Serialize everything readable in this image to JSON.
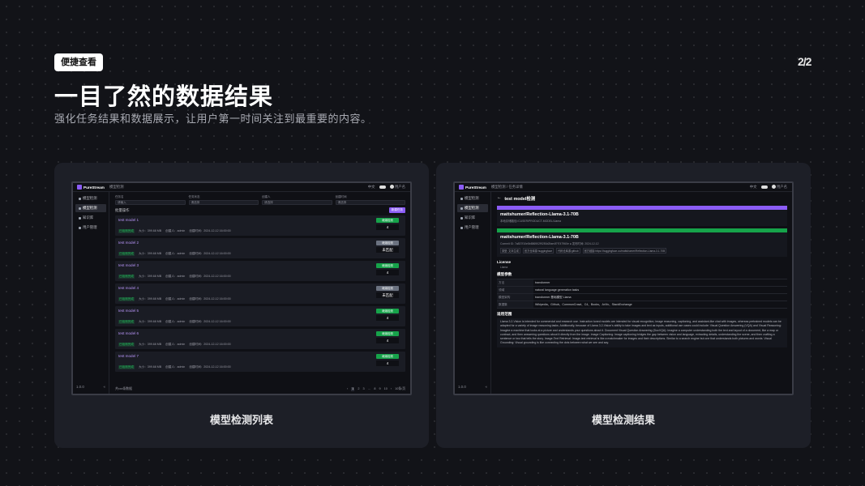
{
  "slide": {
    "tag": "便捷查看",
    "page": "2/2",
    "title": "一目了然的数据结果",
    "subtitle": "强化任务结果和数据展示，让用户第一时间关注到最重要的内容。",
    "left_caption": "模型检测列表",
    "right_caption": "模型检测结果"
  },
  "app": {
    "brand": "PureStream",
    "version": "1.0.0",
    "user": "用户名",
    "lang": "中文",
    "nav": [
      {
        "label": "模型检测"
      },
      {
        "label": "模型检测"
      },
      {
        "label": "知识库"
      },
      {
        "label": "用户管理"
      }
    ]
  },
  "list_screen": {
    "breadcrumb": "模型检测",
    "filters": [
      {
        "label": "任务名",
        "placeholder": "请输入"
      },
      {
        "label": "任务状态",
        "placeholder": "请选择"
      },
      {
        "label": "创建人",
        "placeholder": "请选择"
      },
      {
        "label": "创建时间",
        "placeholder": "请选择"
      }
    ],
    "bulk_label": "批量操作",
    "new_button": "新建任务",
    "rows": [
      {
        "name": "test model 1",
        "status": "已检测完成",
        "size": "大小：399.68 MB",
        "creator": "创建人：admin",
        "time": "创建时间：2024-12-12 16:00:00",
        "action": "继续检测",
        "action_type": "green",
        "count": "4"
      },
      {
        "name": "test model 2",
        "status": "已检测完成",
        "size": "大小：399.68 MB",
        "creator": "创建人：admin",
        "time": "创建时间：2024-12-12 16:00:00",
        "action": "继续检测",
        "action_type": "gray",
        "count": "未匹配"
      },
      {
        "name": "test model 3",
        "status": "已检测完成",
        "size": "大小：399.68 MB",
        "creator": "创建人：admin",
        "time": "创建时间：2024-12-12 16:00:00",
        "action": "继续检测",
        "action_type": "green",
        "count": "4"
      },
      {
        "name": "test model 4",
        "status": "已检测完成",
        "size": "大小：399.68 MB",
        "creator": "创建人：admin",
        "time": "创建时间：2024-12-12 16:00:00",
        "action": "继续检测",
        "action_type": "gray",
        "count": "未匹配"
      },
      {
        "name": "test model 5",
        "status": "已检测完成",
        "size": "大小：399.68 MB",
        "creator": "创建人：admin",
        "time": "创建时间：2024-12-12 16:00:00",
        "action": "继续检测",
        "action_type": "green",
        "count": "4"
      },
      {
        "name": "test model 6",
        "status": "已检测完成",
        "size": "大小：399.68 MB",
        "creator": "创建人：admin",
        "time": "创建时间：2024-12-12 16:00:00",
        "action": "继续检测",
        "action_type": "green",
        "count": "4"
      },
      {
        "name": "test model 7",
        "status": "已检测完成",
        "size": "大小：399.68 MB",
        "creator": "创建人：admin",
        "time": "创建时间：2024-12-12 16:00:00",
        "action": "继续检测",
        "action_type": "green",
        "count": "4"
      }
    ],
    "total": "共xxx条数据",
    "pages": [
      "1",
      "2",
      "3",
      "…",
      "8",
      "9",
      "10"
    ],
    "page_size": "10条/页"
  },
  "detail_screen": {
    "breadcrumb": "模型检测 / 任务详情",
    "title": "test model检测",
    "model_name": "mattshumer/Reflection-Llama-3.1-70B",
    "model_sub": "本地存储路径:/CUSER/PRODUCT-MODEL/Llama",
    "model_name_2": "mattshumer/Reflection-Llama-3.1-70B",
    "meta": "Commit ID: 7a837f10e5b886902f9250d2fae4f7f747960e ● 发布时间: 2024-12-12",
    "tags": [
      "类型: 文本生成",
      "官方仓库源:huggingface",
      "代码仓库源:github",
      "官方链接:https://huggingface.co/mattshumer/Reflection-Llama-3.1-70B"
    ],
    "license_title": "License",
    "license_value": "Llama",
    "params_title": "模型参数",
    "params": [
      {
        "k": "方法",
        "v": "transformer"
      },
      {
        "k": "领域",
        "v": "natural language generation tasks"
      },
      {
        "k": "模型架构",
        "v": "transformer      基础模型      Llama"
      },
      {
        "k": "数据集",
        "v": "Wikipedia、Github、CommonCrawl、C4、Books、ArXiv、StackExchange"
      }
    ],
    "scope_title": "适用范围",
    "scope_text": "Llama 3.2-Vision is intended for commercial and research use. Instruction tuned models are intended for visual recognition, image reasoning, captioning, and assistant-like chat with images, whereas pretrained models can be adapted for a variety of image reasoning tasks. Additionally, because of Llama 3.2-Vision's ability to take images and text as inputs, additional use cases could include: Visual Question Answering (VQA) and Visual Reasoning: Imagine a machine that looks at a picture and understands your questions about it. Document Visual Question Answering (DocVQA): Imagine a computer understanding both the text and layout of a document, like a map or contract, and then answering questions about it directly from the image. Image Captioning: Image captioning bridges the gap between vision and language, extracting details, understanding the scene, and then crafting a sentence or two that tells the story. Image-Text Retrieval: Image-text retrieval is like a matchmaker for images and their descriptions. Similar to a search engine but one that understands both pictures and words. Visual Grounding: Visual grounding is like connecting the dots between what we see and say."
  }
}
